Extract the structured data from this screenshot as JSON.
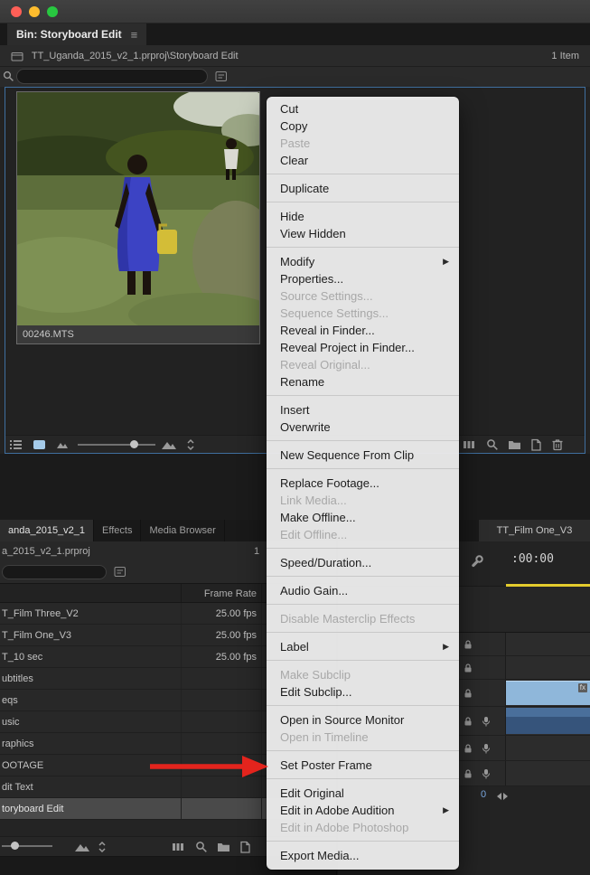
{
  "window": {
    "title_tab": "Bin: Storyboard Edit",
    "breadcrumb": "TT_Uganda_2015_v2_1.prproj\\Storyboard Edit",
    "item_count": "1 Item"
  },
  "bin": {
    "clip_name": "00246.MTS",
    "search_value": ""
  },
  "context_menu": {
    "groups": [
      [
        {
          "label": "Cut"
        },
        {
          "label": "Copy"
        },
        {
          "label": "Paste",
          "disabled": true
        },
        {
          "label": "Clear"
        }
      ],
      [
        {
          "label": "Duplicate"
        }
      ],
      [
        {
          "label": "Hide"
        },
        {
          "label": "View Hidden"
        }
      ],
      [
        {
          "label": "Modify",
          "submenu": true
        },
        {
          "label": "Properties..."
        },
        {
          "label": "Source Settings...",
          "disabled": true
        },
        {
          "label": "Sequence Settings...",
          "disabled": true
        },
        {
          "label": "Reveal in Finder..."
        },
        {
          "label": "Reveal Project in Finder..."
        },
        {
          "label": "Reveal Original...",
          "disabled": true
        },
        {
          "label": "Rename"
        }
      ],
      [
        {
          "label": "Insert"
        },
        {
          "label": "Overwrite"
        }
      ],
      [
        {
          "label": "New Sequence From Clip"
        }
      ],
      [
        {
          "label": "Replace Footage..."
        },
        {
          "label": "Link Media...",
          "disabled": true
        },
        {
          "label": "Make Offline..."
        },
        {
          "label": "Edit Offline...",
          "disabled": true
        }
      ],
      [
        {
          "label": "Speed/Duration..."
        }
      ],
      [
        {
          "label": "Audio Gain..."
        }
      ],
      [
        {
          "label": "Disable Masterclip Effects",
          "disabled": true
        }
      ],
      [
        {
          "label": "Label",
          "submenu": true
        }
      ],
      [
        {
          "label": "Make Subclip",
          "disabled": true
        },
        {
          "label": "Edit Subclip..."
        }
      ],
      [
        {
          "label": "Open in Source Monitor"
        },
        {
          "label": "Open in Timeline",
          "disabled": true
        }
      ],
      [
        {
          "label": "Set Poster Frame"
        }
      ],
      [
        {
          "label": "Edit Original"
        },
        {
          "label": "Edit in Adobe Audition",
          "submenu": true
        },
        {
          "label": "Edit in Adobe Photoshop",
          "disabled": true
        }
      ],
      [
        {
          "label": "Export Media..."
        }
      ]
    ]
  },
  "project_panel": {
    "tabs": [
      {
        "label": "anda_2015_v2_1",
        "active": true
      },
      {
        "label": "Effects",
        "active": false
      },
      {
        "label": "Media Browser",
        "active": false
      }
    ],
    "project_label": "a_2015_v2_1.prproj",
    "count_hint": "1",
    "column_header": "Frame Rate",
    "rows": [
      {
        "name": "T_Film Three_V2",
        "frame_rate": "25.00 fps",
        "selected": false
      },
      {
        "name": "T_Film One_V3",
        "frame_rate": "25.00 fps",
        "selected": false
      },
      {
        "name": "T_10 sec",
        "frame_rate": "25.00 fps",
        "selected": false
      },
      {
        "name": "ubtitles",
        "frame_rate": "",
        "selected": false
      },
      {
        "name": "eqs",
        "frame_rate": "",
        "selected": false
      },
      {
        "name": "usic",
        "frame_rate": "",
        "selected": false
      },
      {
        "name": "raphics",
        "frame_rate": "",
        "selected": false
      },
      {
        "name": "OOTAGE",
        "frame_rate": "",
        "selected": false
      },
      {
        "name": "dit Text",
        "frame_rate": "",
        "selected": false
      },
      {
        "name": "toryboard Edit",
        "frame_rate": "",
        "selected": true
      }
    ]
  },
  "timeline": {
    "tab": "TT_Film One_V3",
    "timecode": ":00:00",
    "marker_label": "0",
    "clip_badge": "fx",
    "tracks": [
      {
        "kind": "video",
        "clip": null
      },
      {
        "kind": "video",
        "clip": null
      },
      {
        "kind": "video",
        "clip": "light"
      },
      {
        "kind": "audio",
        "clip": "steel"
      },
      {
        "kind": "audio",
        "clip": null
      },
      {
        "kind": "audio",
        "clip": null
      }
    ]
  },
  "annotation": {
    "arrow_points_to": "Set Poster Frame"
  },
  "colors": {
    "accent_blue": "#3f6f9f",
    "clip_blue_light": "#8fb7da",
    "clip_blue_dark": "#36547b",
    "arrow_red": "#e3241d",
    "yellow_bar": "#e3cb2d",
    "menu_bg": "#eaeaea"
  }
}
